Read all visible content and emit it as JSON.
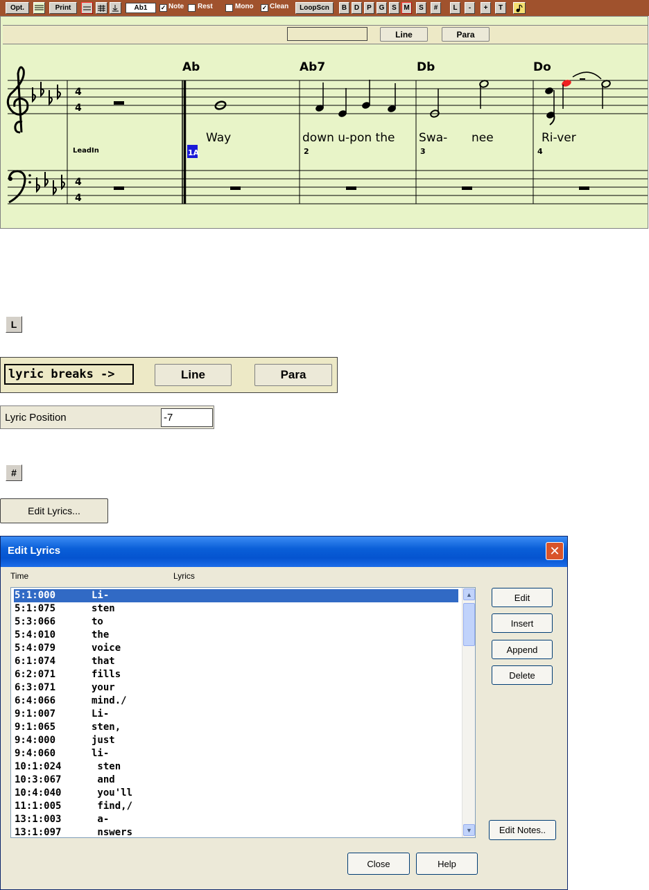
{
  "toolbar": {
    "opt": "Opt.",
    "print": "Print",
    "chord_field": "Ab1",
    "note_label": "Note",
    "rest_label": "Rest",
    "mono_label": "Mono",
    "clean_label": "Clean",
    "loopscn": "LoopScn",
    "buttons": [
      "B",
      "D",
      "P",
      "G",
      "S",
      "M",
      "S",
      "#",
      "L",
      "-",
      "+",
      "T"
    ],
    "note_checked": true,
    "rest_checked": false,
    "mono_checked": false,
    "clean_checked": true
  },
  "notation": {
    "line_button": "Line",
    "para_button": "Para",
    "chords": [
      "Ab",
      "Ab7",
      "Db",
      "Do"
    ],
    "lyrics": [
      "Way",
      "down u-pon the",
      "Swa-",
      "nee",
      "Ri-ver"
    ],
    "measure_numbers": [
      "1A",
      "2",
      "3",
      "4"
    ],
    "leadin_label": "LeadIn",
    "time_signature": [
      "4",
      "4"
    ]
  },
  "l_button": "L",
  "lyric_breaks": {
    "label": "lyric breaks ->",
    "line_button": "Line",
    "para_button": "Para"
  },
  "lyric_position": {
    "label": "Lyric Position",
    "value": "-7"
  },
  "hash_button": "#",
  "edit_lyrics_button": "Edit Lyrics...",
  "dialog": {
    "title": "Edit Lyrics",
    "col_time": "Time",
    "col_lyrics": "Lyrics",
    "rows": [
      {
        "time": "5:1:000",
        "lyric": "Li-",
        "selected": true
      },
      {
        "time": "5:1:075",
        "lyric": "sten"
      },
      {
        "time": "5:3:066",
        "lyric": "to"
      },
      {
        "time": "5:4:010",
        "lyric": "the"
      },
      {
        "time": "5:4:079",
        "lyric": "voice"
      },
      {
        "time": "6:1:074",
        "lyric": "that"
      },
      {
        "time": "6:2:071",
        "lyric": "fills"
      },
      {
        "time": "6:3:071",
        "lyric": "your"
      },
      {
        "time": "6:4:066",
        "lyric": "mind./"
      },
      {
        "time": "9:1:007",
        "lyric": "Li-"
      },
      {
        "time": "9:1:065",
        "lyric": "sten,"
      },
      {
        "time": "9:4:000",
        "lyric": "just"
      },
      {
        "time": "9:4:060",
        "lyric": "li-"
      },
      {
        "time": "10:1:024",
        "lyric": " sten"
      },
      {
        "time": "10:3:067",
        "lyric": " and"
      },
      {
        "time": "10:4:040",
        "lyric": " you'll"
      },
      {
        "time": "11:1:005",
        "lyric": " find,/"
      },
      {
        "time": "13:1:003",
        "lyric": " a-"
      },
      {
        "time": "13:1:097",
        "lyric": " nswers"
      }
    ],
    "buttons": {
      "edit": "Edit",
      "insert": "Insert",
      "append": "Append",
      "delete": "Delete",
      "edit_notes": "Edit Notes..",
      "close": "Close",
      "help": "Help"
    }
  }
}
